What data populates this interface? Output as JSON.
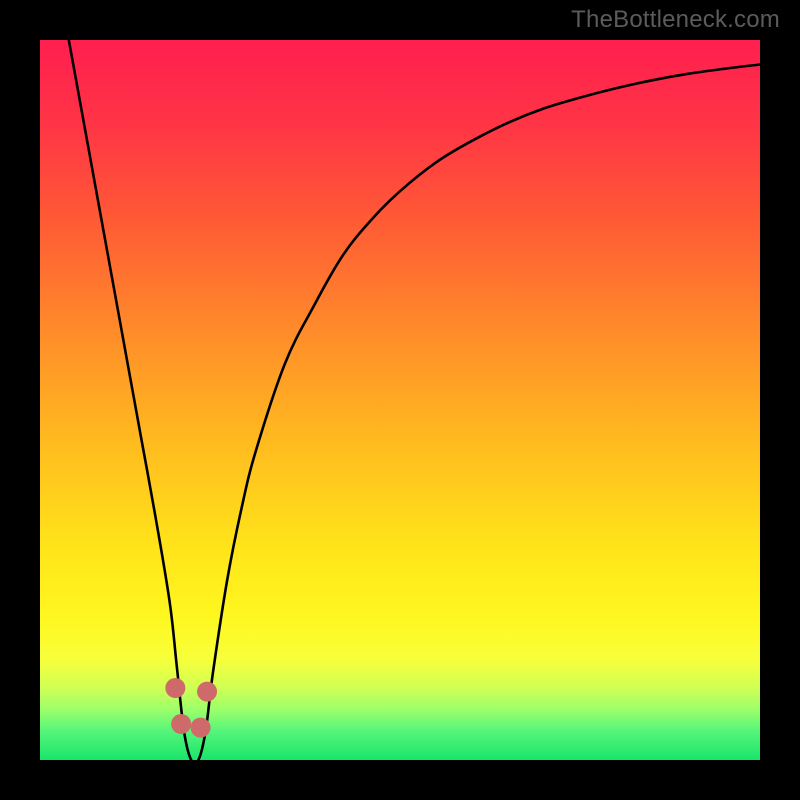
{
  "watermark": "TheBottleneck.com",
  "chart_data": {
    "type": "line",
    "title": "",
    "xlabel": "",
    "ylabel": "",
    "xlim": [
      0,
      100
    ],
    "ylim": [
      0,
      100
    ],
    "grid": false,
    "legend": false,
    "series": [
      {
        "name": "bottleneck-curve",
        "x": [
          4,
          6,
          8,
          10,
          12,
          14,
          16,
          18,
          19,
          20,
          21,
          22,
          23,
          24,
          26,
          28,
          30,
          34,
          38,
          42,
          46,
          50,
          55,
          60,
          65,
          70,
          75,
          80,
          85,
          90,
          95,
          100
        ],
        "y": [
          100,
          89,
          78,
          67,
          56,
          45,
          34,
          22,
          13,
          4,
          0,
          0,
          4,
          12,
          25,
          35,
          43,
          55,
          63,
          70,
          75,
          79,
          83,
          86,
          88.5,
          90.5,
          92,
          93.3,
          94.4,
          95.3,
          96,
          96.6
        ]
      }
    ],
    "markers": {
      "name": "highlight-dots",
      "color": "#cf6a6a",
      "points": [
        {
          "x": 18.8,
          "y": 10
        },
        {
          "x": 19.6,
          "y": 5
        },
        {
          "x": 22.3,
          "y": 4.5
        },
        {
          "x": 23.2,
          "y": 9.5
        }
      ]
    },
    "background": {
      "type": "vertical-gradient",
      "stops": [
        {
          "pos": 0.0,
          "color": "#ff1f4f"
        },
        {
          "pos": 0.12,
          "color": "#ff3545"
        },
        {
          "pos": 0.25,
          "color": "#ff5a35"
        },
        {
          "pos": 0.4,
          "color": "#ff8a2a"
        },
        {
          "pos": 0.55,
          "color": "#ffb81f"
        },
        {
          "pos": 0.7,
          "color": "#ffe31a"
        },
        {
          "pos": 0.8,
          "color": "#fff71f"
        },
        {
          "pos": 0.86,
          "color": "#f7ff3a"
        },
        {
          "pos": 0.9,
          "color": "#cfff55"
        },
        {
          "pos": 0.93,
          "color": "#9cff6a"
        },
        {
          "pos": 0.96,
          "color": "#55f57a"
        },
        {
          "pos": 1.0,
          "color": "#19e56a"
        }
      ]
    }
  }
}
